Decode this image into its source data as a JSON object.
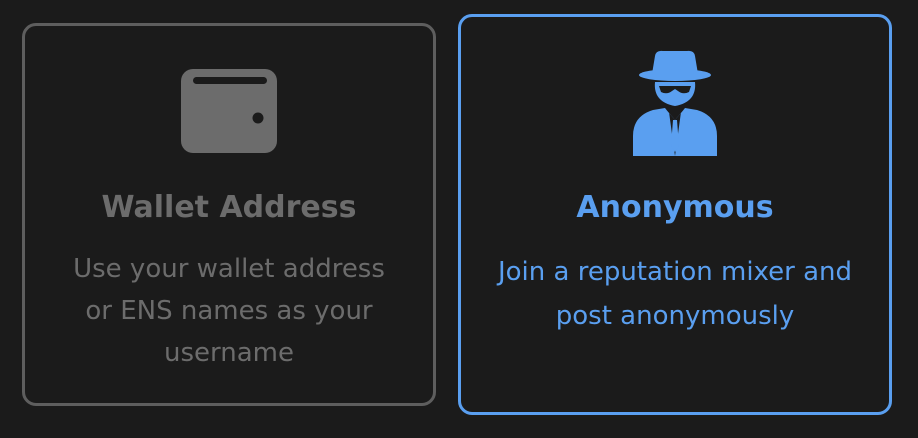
{
  "options": {
    "wallet": {
      "icon": "wallet-icon",
      "title": "Wallet Address",
      "description": "Use your wallet address or ENS names as your username",
      "selected": false
    },
    "anonymous": {
      "icon": "spy-icon",
      "title": "Anonymous",
      "description": "Join a reputation mixer and post anonymously",
      "selected": true
    }
  },
  "colors": {
    "background": "#1b1b1b",
    "unselected_border": "#5e5e5e",
    "unselected_text": "#6c6c6c",
    "accent": "#5a9ff0"
  }
}
